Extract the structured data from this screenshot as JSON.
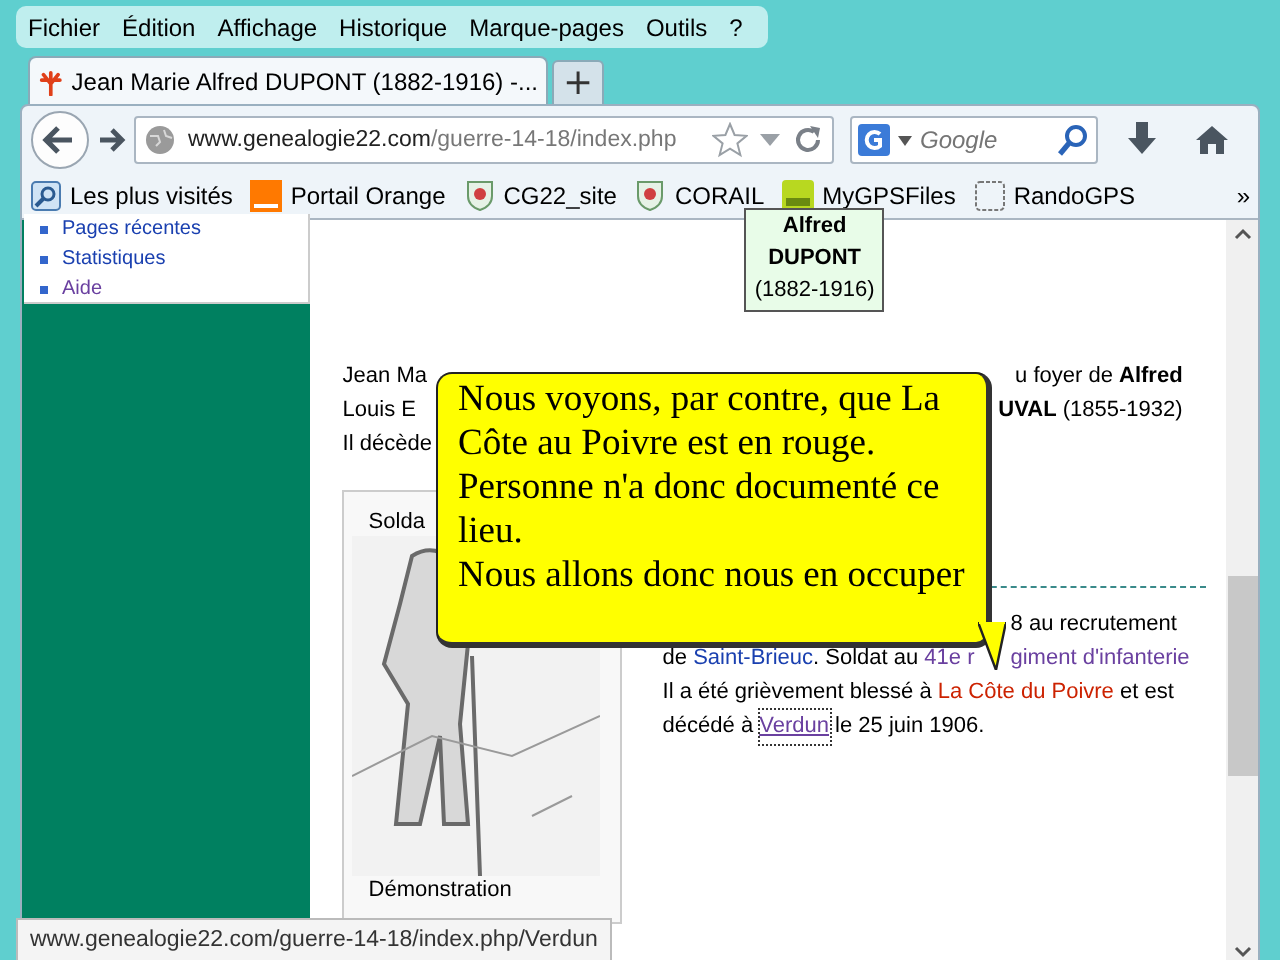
{
  "menu_bar": {
    "items": [
      {
        "label": "Fichier"
      },
      {
        "label": "Édition"
      },
      {
        "label": "Affichage"
      },
      {
        "label": "Historique"
      },
      {
        "label": "Marque-pages"
      },
      {
        "label": "Outils"
      },
      {
        "label": "?"
      }
    ]
  },
  "tabs": [
    {
      "title": "Jean Marie Alfred DUPONT (1882-1916) -...",
      "selected": true
    }
  ],
  "new_tab_button": "+",
  "address_bar": {
    "host": "www.genealogie22.com",
    "path": "/guerre-14-18/index.php"
  },
  "search": {
    "placeholder": "Google"
  },
  "bookmarks": [
    {
      "label": "Les plus visités",
      "kind": "history"
    },
    {
      "label": "Portail Orange",
      "kind": "orange"
    },
    {
      "label": "CG22_site",
      "kind": "crest"
    },
    {
      "label": "CORAIL",
      "kind": "crest"
    },
    {
      "label": "MyGPSFiles",
      "kind": "gps"
    },
    {
      "label": "RandoGPS",
      "kind": "blank"
    }
  ],
  "bookmarks_more": "»",
  "sidebar": {
    "items": [
      {
        "label": "Pages récentes",
        "visited": false
      },
      {
        "label": "Statistiques",
        "visited": false
      },
      {
        "label": "Aide",
        "visited": true
      }
    ]
  },
  "person_card": {
    "lines": [
      "Alfred",
      "DUPONT",
      "(1882-1916)"
    ]
  },
  "intro": [
    {
      "left": "Jean Ma",
      "right": "u foyer de **Alfred**"
    },
    {
      "left": "Louis E",
      "right": "**UVAL** (1855-1932)"
    },
    {
      "left": "Il décède"
    }
  ],
  "figure": {
    "caption_top": "Solda",
    "caption_bottom": "Démonstration"
  },
  "bio": {
    "line_1": "8 au recrutement",
    "line_2": [
      {
        "text": "de ",
        "kind": "plain"
      },
      {
        "text": "Saint-Brieuc",
        "kind": "link"
      },
      {
        "text": ". Soldat au ",
        "kind": "plain"
      },
      {
        "text": "41e r",
        "kind": "visited"
      },
      {
        "kind": "tail"
      },
      {
        "text": "giment d'infanterie",
        "kind": "visited"
      }
    ],
    "line_3": [
      {
        "text": "Il a été grièvement blessé à ",
        "kind": "plain"
      },
      {
        "text": "La Côte du Poivre",
        "kind": "missing"
      },
      {
        "text": " et est",
        "kind": "plain"
      }
    ],
    "line_4": [
      {
        "text": "décédé à ",
        "kind": "plain"
      },
      {
        "text": "Verdun",
        "kind": "focused"
      },
      {
        "text": " le 25 juin 1906.",
        "kind": "plain"
      }
    ]
  },
  "callout": {
    "lines": [
      "Nous voyons, par contre, que La",
      "Côte au Poivre est en rouge.",
      "Personne n'a donc documenté ce",
      "lieu.",
      "Nous allons donc nous en occuper"
    ]
  },
  "status_bar": "www.genealogie22.com/guerre-14-18/index.php/Verdun"
}
